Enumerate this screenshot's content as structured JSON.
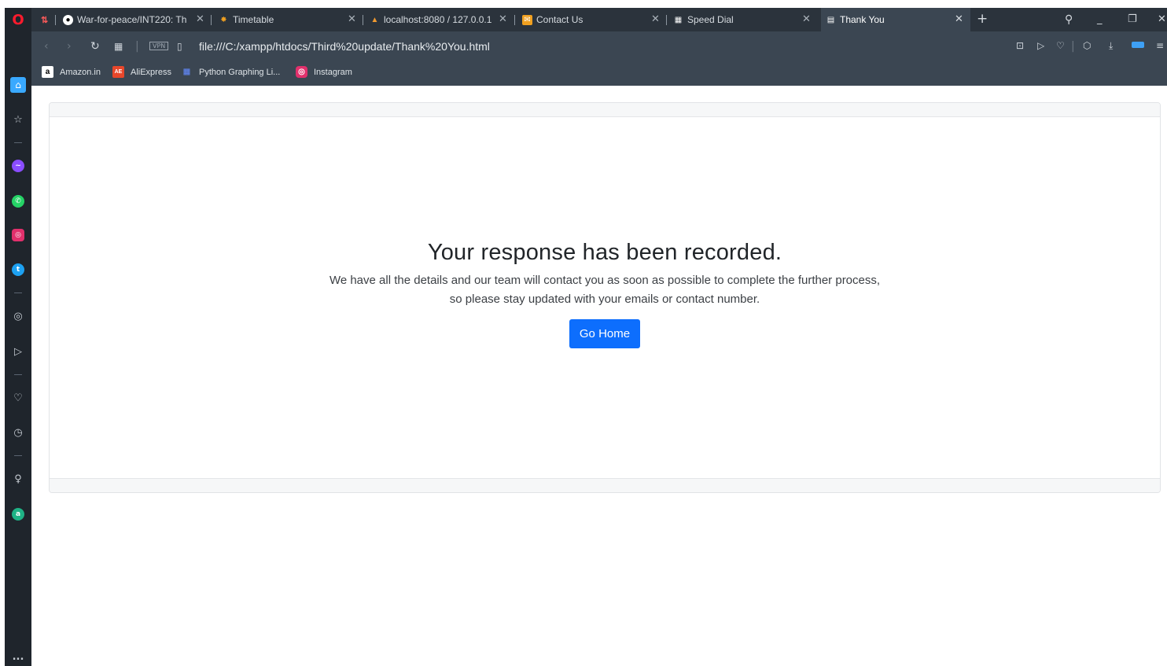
{
  "browser": {
    "tabs": [
      {
        "icon": "github-icon",
        "label": "War-for-peace/INT220: Th",
        "active": false
      },
      {
        "icon": "timetable-icon",
        "label": "Timetable",
        "active": false
      },
      {
        "icon": "phpmyadmin-icon",
        "label": "localhost:8080 / 127.0.0.1 /",
        "active": false
      },
      {
        "icon": "mail-icon",
        "label": "Contact Us",
        "active": false
      },
      {
        "icon": "speed-dial-icon",
        "label": "Speed Dial",
        "active": false
      },
      {
        "icon": "file-icon",
        "label": "Thank You",
        "active": true
      }
    ],
    "address": "file:///C:/xampp/htdocs/Third%20update/Thank%20You.html",
    "vpn_label": "VPN",
    "bookmarks": [
      {
        "icon": "amazon-icon",
        "icon_text": "a",
        "label": "Amazon.in"
      },
      {
        "icon": "aliexpress-icon",
        "icon_text": "AE",
        "label": "AliExpress"
      },
      {
        "icon": "python-graphing-icon",
        "icon_text": "▦",
        "label": "Python Graphing Li..."
      },
      {
        "icon": "instagram-icon",
        "icon_text": "◎",
        "label": "Instagram"
      }
    ],
    "sidebar_more": "..."
  },
  "page": {
    "heading": "Your response has been recorded.",
    "message_line1": "We have all the details and our team will contact you as soon as possible to complete the further process,",
    "message_line2": "so please stay updated with your emails or contact number.",
    "button_label": "Go Home"
  },
  "colors": {
    "primary_button": "#0d6efd",
    "chrome_dark": "#2b333c",
    "chrome_mid": "#3b4652"
  }
}
